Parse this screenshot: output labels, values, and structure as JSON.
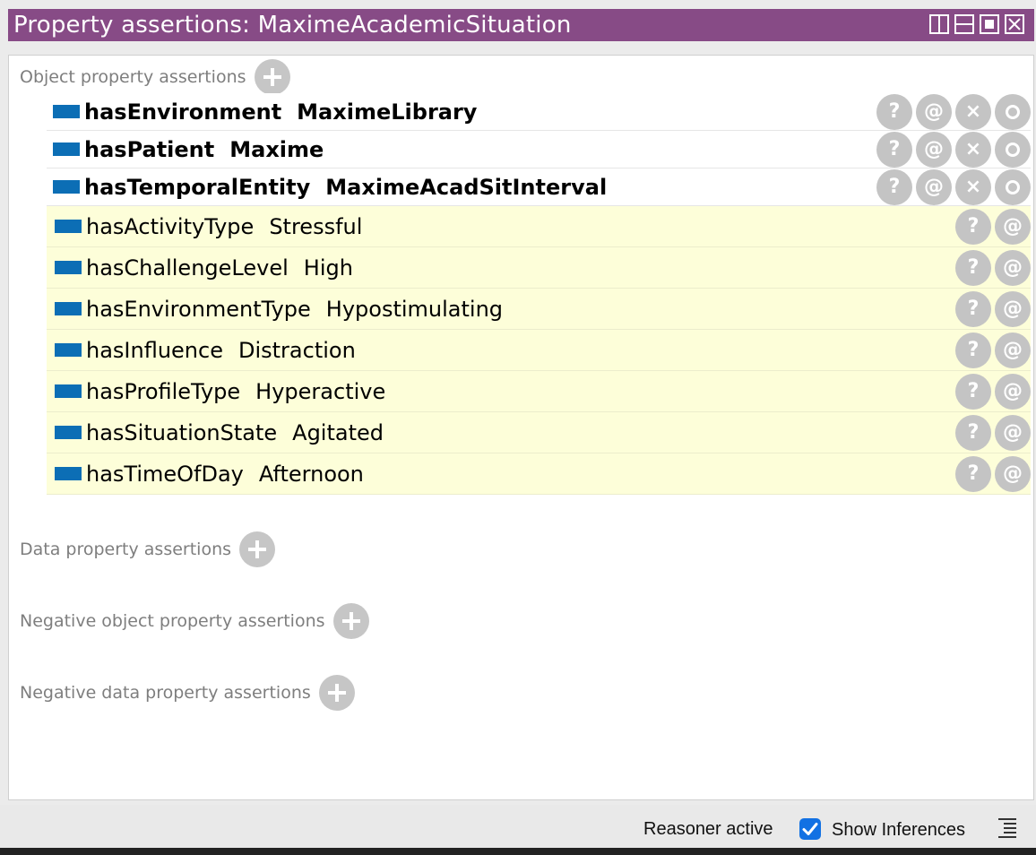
{
  "window": {
    "title": "Property assertions: MaximeAcademicSituation",
    "title_bar_color": "#874b86"
  },
  "sections": {
    "object_property_assertions": "Object property assertions",
    "data_property_assertions": "Data property assertions",
    "negative_object_property_assertions": "Negative object property assertions",
    "negative_data_property_assertions": "Negative data property assertions"
  },
  "asserted": [
    {
      "property": "hasEnvironment",
      "value": "MaximeLibrary"
    },
    {
      "property": "hasPatient",
      "value": "Maxime"
    },
    {
      "property": "hasTemporalEntity",
      "value": "MaximeAcadSitInterval"
    }
  ],
  "inferred": [
    {
      "property": "hasActivityType",
      "value": "Stressful"
    },
    {
      "property": "hasChallengeLevel",
      "value": "High"
    },
    {
      "property": "hasEnvironmentType",
      "value": "Hypostimulating"
    },
    {
      "property": "hasInfluence",
      "value": "Distraction"
    },
    {
      "property": "hasProfileType",
      "value": "Hyperactive"
    },
    {
      "property": "hasSituationState",
      "value": "Agitated"
    },
    {
      "property": "hasTimeOfDay",
      "value": "Afternoon"
    }
  ],
  "actions": {
    "explain": "?",
    "annotate": "@",
    "delete": "×"
  },
  "status": {
    "reasoner": "Reasoner active",
    "show_inferences_label": "Show Inferences",
    "show_inferences_checked": true
  },
  "colors": {
    "property_icon": "#0c6eb5",
    "inferred_row_bg": "#fdfed9",
    "checkbox": "#1271e3"
  }
}
